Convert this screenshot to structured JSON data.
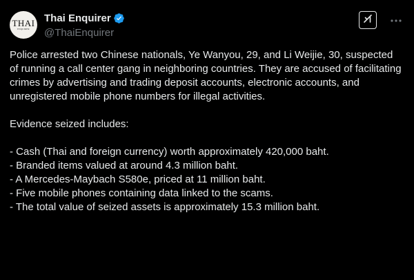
{
  "author": {
    "display_name": "Thai Enquirer",
    "handle": "@ThaiEnquirer",
    "avatar_text": "THAI",
    "avatar_subtext": "ENQUIRER",
    "verified_icon": "verified-badge-icon",
    "verified_color": "#1d9bf0"
  },
  "actions": {
    "grok_icon": "grok-icon",
    "more_icon": "more-horizontal-icon"
  },
  "post": {
    "paragraph_1": "Police arrested two Chinese nationals, Ye Wanyou, 29, and Li Weijie, 30, suspected of running a call center gang in neighboring countries. They are accused of facilitating crimes by advertising and trading deposit accounts, electronic accounts, and unregistered mobile phone numbers for illegal activities.",
    "evidence_heading": "Evidence seized includes:",
    "evidence_items": [
      "- Cash (Thai and foreign currency) worth approximately 420,000 baht.",
      "- Branded items valued at around 4.3 million baht.",
      "- A Mercedes-Maybach S580e, priced at 11 million baht.",
      "- Five mobile phones containing data linked to the scams.",
      "- The total value of seized assets is approximately 15.3 million baht."
    ]
  },
  "colors": {
    "background": "#000000",
    "text_primary": "#e7e9ea",
    "text_secondary": "#71767b"
  }
}
